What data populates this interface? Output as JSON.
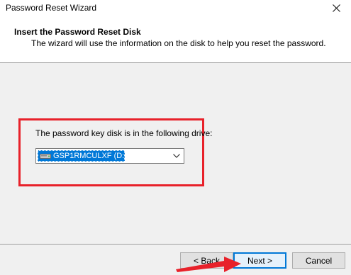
{
  "window": {
    "title": "Password Reset Wizard"
  },
  "header": {
    "title": "Insert the Password Reset Disk",
    "subtitle": "The wizard will use the information on the disk to help you reset the password."
  },
  "main": {
    "drive_label": "The password key disk is in the following drive:",
    "drive_select": {
      "selected": "GSP1RMCULXF (D:)",
      "icon": "drive-icon"
    }
  },
  "buttons": {
    "back_label": "< Back",
    "next_label": "Next >",
    "cancel_label": "Cancel"
  },
  "annotations": {
    "highlight_color": "#e8212a",
    "arrow_color": "#e8212a"
  },
  "colors": {
    "accent": "#0078d7"
  }
}
